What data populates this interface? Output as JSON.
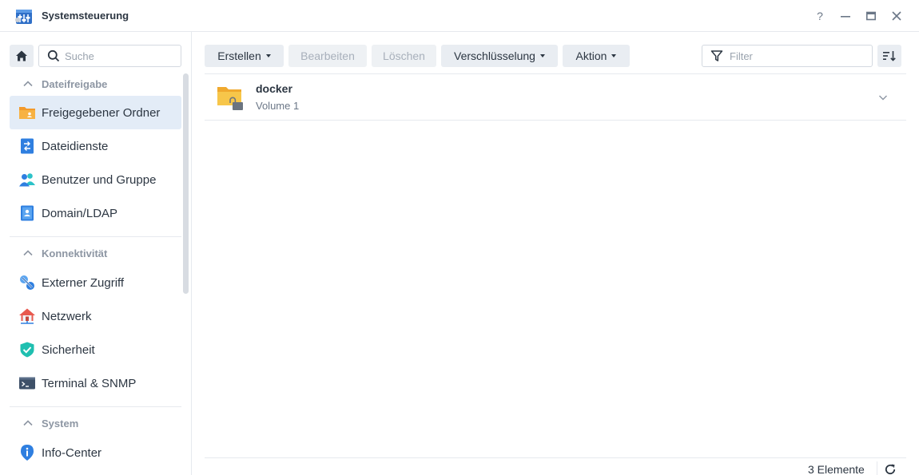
{
  "window": {
    "title": "Systemsteuerung",
    "help_label": "?",
    "icons": [
      "help-icon",
      "minimize-icon",
      "maximize-icon",
      "close-icon"
    ]
  },
  "sidebar": {
    "search_placeholder": "Suche",
    "sections": [
      {
        "title": "Dateifreigabe",
        "items": [
          {
            "label": "Freigegebener Ordner",
            "icon": "shared-folder-icon",
            "active": true
          },
          {
            "label": "Dateidienste",
            "icon": "file-services-icon"
          },
          {
            "label": "Benutzer und Gruppe",
            "icon": "users-icon"
          },
          {
            "label": "Domain/LDAP",
            "icon": "domain-icon"
          }
        ]
      },
      {
        "title": "Konnektivität",
        "items": [
          {
            "label": "Externer Zugriff",
            "icon": "external-access-icon"
          },
          {
            "label": "Netzwerk",
            "icon": "network-icon"
          },
          {
            "label": "Sicherheit",
            "icon": "security-shield-icon"
          },
          {
            "label": "Terminal & SNMP",
            "icon": "terminal-icon"
          }
        ]
      },
      {
        "title": "System",
        "items": [
          {
            "label": "Info-Center",
            "icon": "info-icon"
          }
        ]
      }
    ]
  },
  "toolbar": {
    "create": "Erstellen",
    "edit": "Bearbeiten",
    "delete": "Löschen",
    "encryption": "Verschlüsselung",
    "action": "Aktion",
    "filter_placeholder": "Filter"
  },
  "folders": [
    {
      "name": "docker",
      "volume": "Volume 1"
    }
  ],
  "footer": {
    "count": "3 Elemente"
  },
  "colors": {
    "accent": "#3b82d8",
    "active_bg": "#e3ecf7",
    "folder_yellow": "#f5c043"
  }
}
